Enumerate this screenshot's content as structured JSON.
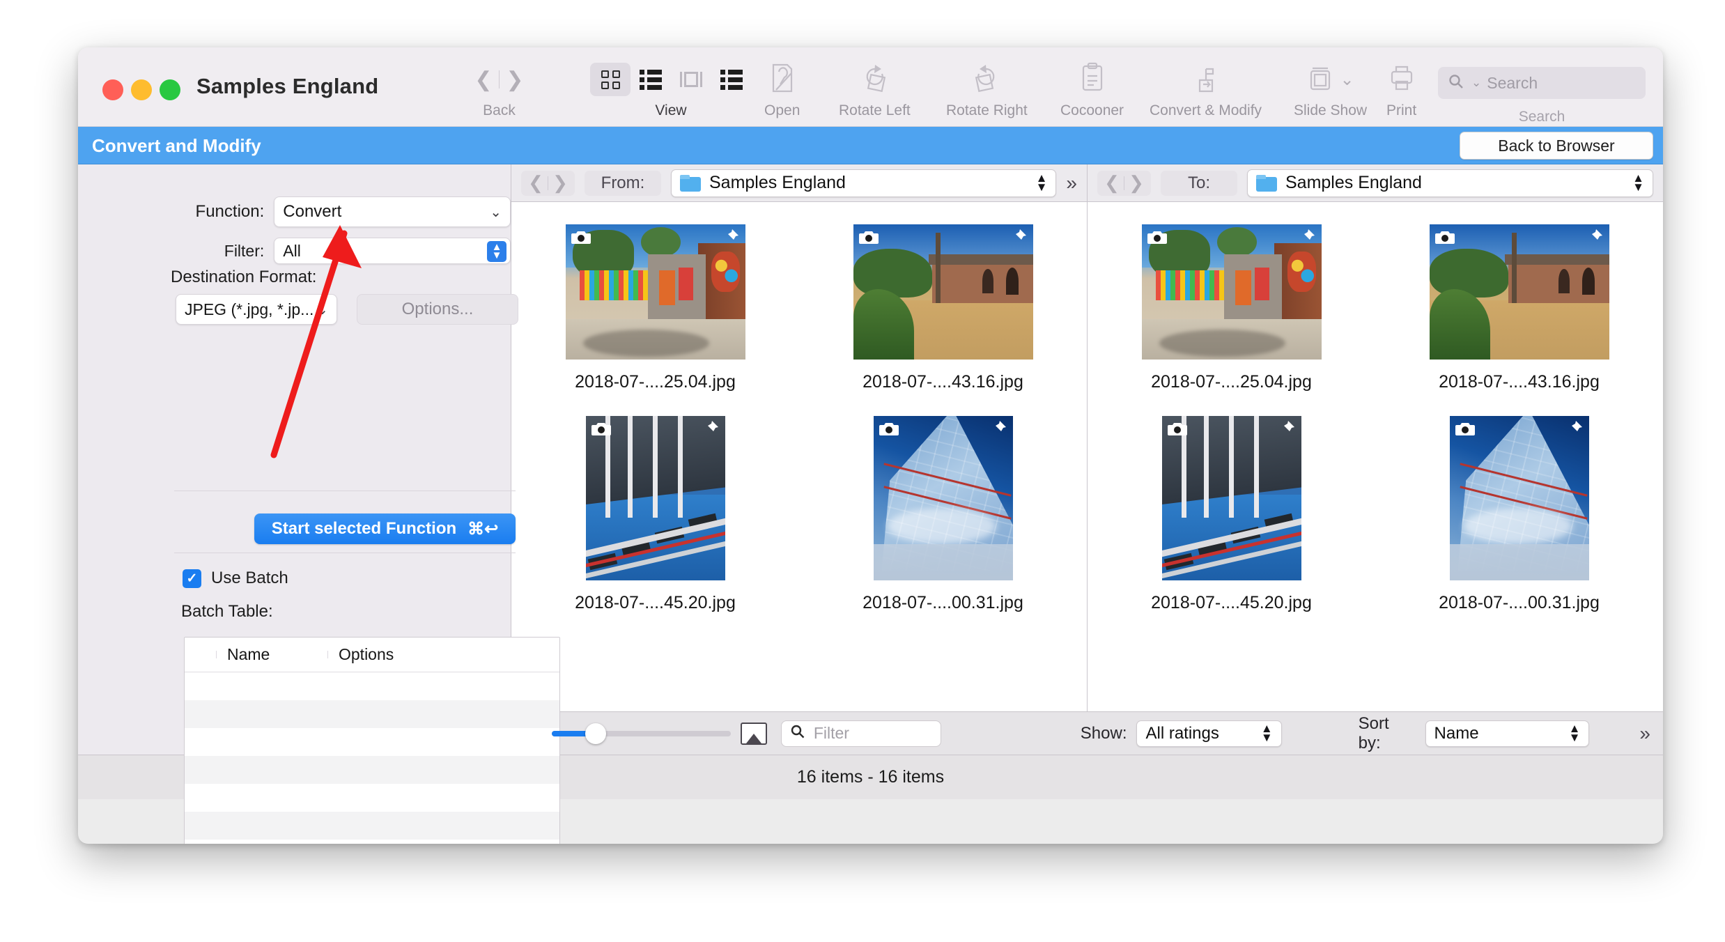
{
  "window": {
    "title": "Samples England",
    "traffic_lights": [
      "close",
      "minimize",
      "zoom"
    ]
  },
  "toolbar": {
    "back_label": "Back",
    "view_label": "View",
    "open_label": "Open",
    "rotate_left_label": "Rotate Left",
    "rotate_right_label": "Rotate Right",
    "cocooner_label": "Cocooner",
    "convert_modify_label": "Convert & Modify",
    "slide_show_label": "Slide Show",
    "print_label": "Print",
    "search_label": "Search",
    "search_placeholder": "Search",
    "overflow_label": "»"
  },
  "mode_bar": {
    "title": "Convert and Modify",
    "back_to_browser_label": "Back to Browser",
    "accent_color": "#4ea3f0"
  },
  "left_panel": {
    "function_label": "Function:",
    "function_value": "Convert",
    "filter_label": "Filter:",
    "filter_value": "All",
    "destination_format_label": "Destination Format:",
    "destination_format_value": "JPEG (*.jpg, *.jp...",
    "options_label": "Options...",
    "start_label": "Start selected Function",
    "start_shortcut": "⌘↩",
    "use_batch_label": "Use Batch",
    "use_batch_checked": true,
    "batch_table_label": "Batch Table:",
    "batch_columns": [
      "Name",
      "Options"
    ],
    "batch_rows": [],
    "add_label": "+",
    "remove_label": "−",
    "action_label": "⊙"
  },
  "source_pane": {
    "path_label": "From:",
    "folder_name": "Samples England",
    "overflow_label": "»",
    "items": [
      {
        "caption": "2018-07-....25.04.jpg",
        "photo": "street-wall-art",
        "orientation": "landscape"
      },
      {
        "caption": "2018-07-....43.16.jpg",
        "photo": "brick-house-lawn",
        "orientation": "landscape"
      },
      {
        "caption": "2018-07-....45.20.jpg",
        "photo": "glass-walkway",
        "orientation": "portrait"
      },
      {
        "caption": "2018-07-....00.31.jpg",
        "photo": "shard-glass-tower",
        "orientation": "portrait"
      }
    ]
  },
  "dest_pane": {
    "path_label": "To:",
    "folder_name": "Samples England",
    "items": [
      {
        "caption": "2018-07-....25.04.jpg",
        "photo": "street-wall-art",
        "orientation": "landscape"
      },
      {
        "caption": "2018-07-....43.16.jpg",
        "photo": "brick-house-lawn",
        "orientation": "landscape"
      },
      {
        "caption": "2018-07-....45.20.jpg",
        "photo": "glass-walkway",
        "orientation": "portrait"
      },
      {
        "caption": "2018-07-....00.31.jpg",
        "photo": "shard-glass-tower",
        "orientation": "portrait"
      }
    ]
  },
  "browser_toolbar": {
    "filter_placeholder": "Filter",
    "show_label": "Show:",
    "show_value": "All ratings",
    "sort_by_label": "Sort by:",
    "sort_by_value": "Name",
    "overflow_label": "»",
    "zoom_percent": 20
  },
  "status_bar": {
    "text": "16 items - 16 items"
  },
  "annotation": {
    "arrow_color": "#ee1c1c"
  }
}
